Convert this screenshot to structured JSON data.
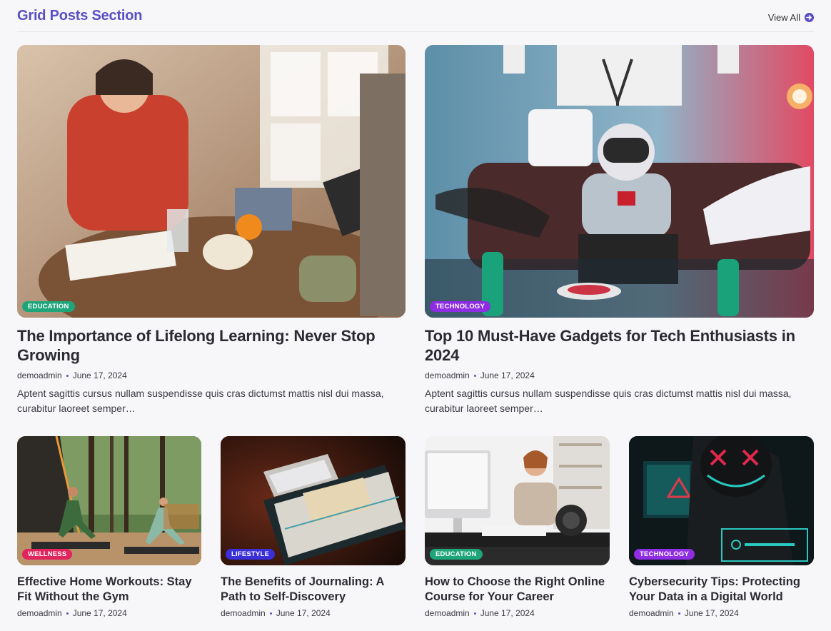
{
  "section": {
    "title": "Grid Posts Section",
    "view_all_label": "View All"
  },
  "posts": [
    {
      "category": "EDUCATION",
      "category_color": "#1fa57a",
      "title": "The Importance of Lifelong Learning: Never Stop Growing",
      "author": "demoadmin",
      "date": "June 17, 2024",
      "excerpt": "Aptent sagittis cursus nullam suspendisse quis cras dictumst mattis nisl dui massa, curabitur laoreet semper…"
    },
    {
      "category": "TECHNOLOGY",
      "category_color": "#8e2de2",
      "title": "Top 10 Must-Have Gadgets for Tech Enthusiasts in 2024",
      "author": "demoadmin",
      "date": "June 17, 2024",
      "excerpt": "Aptent sagittis cursus nullam suspendisse quis cras dictumst mattis nisl dui massa, curabitur laoreet semper…"
    },
    {
      "category": "WELLNESS",
      "category_color": "#e0245e",
      "title": "Effective Home Workouts: Stay Fit Without the Gym",
      "author": "demoadmin",
      "date": "June 17, 2024"
    },
    {
      "category": "LIFESTYLE",
      "category_color": "#3a2fd9",
      "title": "The Benefits of Journaling: A Path to Self-Discovery",
      "author": "demoadmin",
      "date": "June 17, 2024"
    },
    {
      "category": "EDUCATION",
      "category_color": "#1fa57a",
      "title": "How to Choose the Right Online Course for Your Career",
      "author": "demoadmin",
      "date": "June 17, 2024"
    },
    {
      "category": "TECHNOLOGY",
      "category_color": "#8e2de2",
      "title": "Cybersecurity Tips: Protecting Your Data in a Digital World",
      "author": "demoadmin",
      "date": "June 17, 2024"
    }
  ]
}
